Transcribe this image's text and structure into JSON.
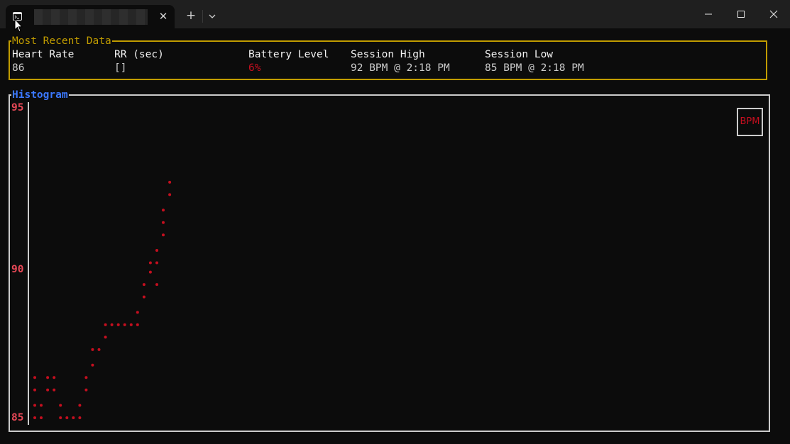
{
  "window": {
    "tab_close_glyph": "✕",
    "new_tab_glyph": "+"
  },
  "recent": {
    "title": "Most Recent Data",
    "columns": [
      {
        "header": "Heart Rate",
        "value": "86",
        "value_color": "#cccccc"
      },
      {
        "header": "RR (sec)",
        "value": "[]",
        "value_color": "#cccccc"
      },
      {
        "header": "Battery Level",
        "value": "6%",
        "value_color": "#c50f1f"
      },
      {
        "header": "Session High",
        "value": "92 BPM @ 2:18 PM",
        "value_color": "#cccccc"
      },
      {
        "header": "Session Low",
        "value": "85 BPM @ 2:18 PM",
        "value_color": "#cccccc"
      }
    ]
  },
  "histogram": {
    "title": "Histogram",
    "legend": "BPM",
    "y_ticks": [
      "95",
      "90",
      "85"
    ]
  },
  "colors": {
    "recent_border": "#c19c00",
    "histogram_title": "#3b78ff",
    "data_dot": "#c50f1f",
    "axis_label": "#e74856"
  },
  "chart_data": {
    "type": "scatter",
    "title": "Histogram",
    "xlabel": "",
    "ylabel": "",
    "ylim": [
      85,
      95
    ],
    "y_ticks": [
      85,
      90,
      95
    ],
    "legend": "BPM",
    "legend_position": "top-right",
    "series": [
      {
        "name": "BPM",
        "color": "#c50f1f",
        "points": [
          [
            1,
            85.0
          ],
          [
            1,
            85.4
          ],
          [
            1,
            85.9
          ],
          [
            1,
            86.3
          ],
          [
            2,
            85.0
          ],
          [
            2,
            85.4
          ],
          [
            3,
            85.9
          ],
          [
            3,
            86.3
          ],
          [
            4,
            85.9
          ],
          [
            4,
            86.3
          ],
          [
            5,
            85.0
          ],
          [
            5,
            85.4
          ],
          [
            6,
            85.0
          ],
          [
            7,
            85.0
          ],
          [
            8,
            85.0
          ],
          [
            8,
            85.4
          ],
          [
            9,
            85.9
          ],
          [
            9,
            86.3
          ],
          [
            10,
            86.7
          ],
          [
            10,
            87.2
          ],
          [
            11,
            87.2
          ],
          [
            12,
            87.6
          ],
          [
            12,
            88.0
          ],
          [
            13,
            88.0
          ],
          [
            14,
            88.0
          ],
          [
            15,
            88.0
          ],
          [
            16,
            88.0
          ],
          [
            17,
            88.0
          ],
          [
            17,
            88.4
          ],
          [
            18,
            88.9
          ],
          [
            18,
            89.3
          ],
          [
            19,
            89.7
          ],
          [
            19,
            90.0
          ],
          [
            20,
            89.3
          ],
          [
            20,
            90.0
          ],
          [
            20,
            90.4
          ],
          [
            21,
            90.9
          ],
          [
            21,
            91.3
          ],
          [
            21,
            91.7
          ],
          [
            22,
            92.2
          ],
          [
            22,
            92.6
          ]
        ]
      }
    ]
  }
}
